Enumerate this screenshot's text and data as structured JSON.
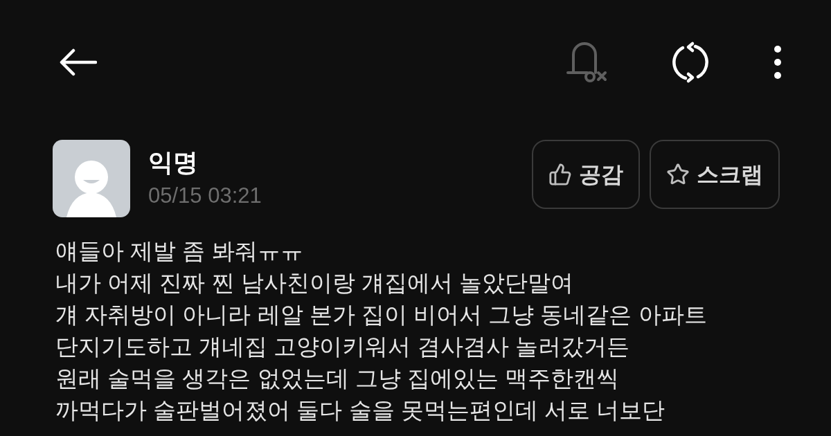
{
  "top_bar": {
    "notifications_on": false
  },
  "post": {
    "author": "익명",
    "time": "05/15 03:21",
    "actions": [
      {
        "kind": "like",
        "label": "공감"
      },
      {
        "kind": "scrap",
        "label": "스크랩"
      }
    ],
    "body": [
      "얘들아 제발 좀 봐줘ㅠㅠ",
      "내가 어제 진짜 찐 남사친이랑 걔집에서 놀았단말여",
      "걔 자취방이 아니라 레알 본가 집이 비어서 그냥 동네같은 아파트",
      "단지기도하고 걔네집 고양이키워서 겸사겸사 놀러갔거든",
      "원래 술먹을 생각은 없었는데 그냥 집에있는 맥주한캔씩",
      "까먹다가 술판벌어졌어 둘다 술을 못먹는편인데 서로 너보단"
    ]
  }
}
